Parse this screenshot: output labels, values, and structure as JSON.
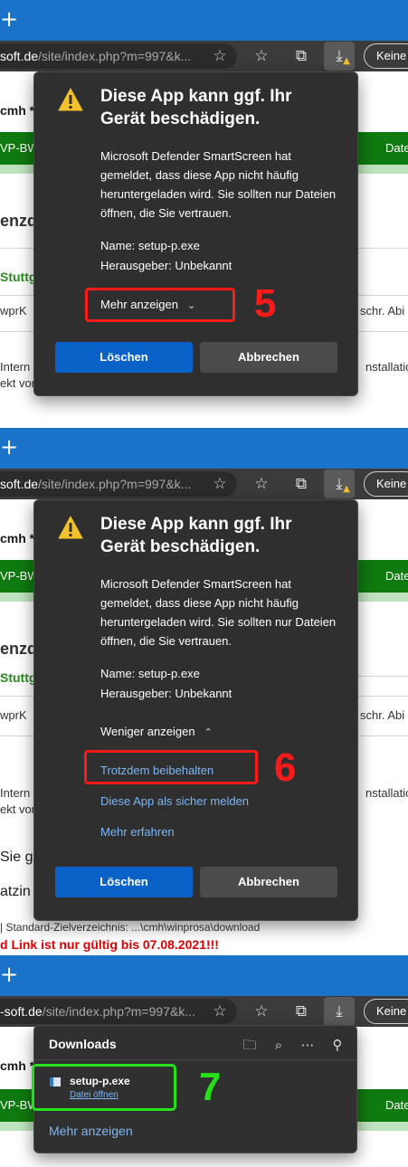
{
  "browser": {
    "new_tab": "+",
    "url_domain": "soft.de",
    "url_path": "/site/index.php?m=997&k...",
    "url_domain_2": "-soft.de",
    "profile_pill": "Keine S",
    "profile_pill_3": "Keine"
  },
  "website": {
    "line_cmh_1": "cmh * S",
    "line_cmh_3": "cmh *",
    "green_left": "VP-BW,",
    "green_left_3": "VP-BW,",
    "green_right": "Date",
    "heading": "enzd",
    "stuttgart": "Stuttg",
    "row_left": "wprK",
    "row_right": "schr. Abi",
    "inter": "Intern",
    "inter_right": "nstallatio",
    "ekt": "ekt vor",
    "sie": "Sie g",
    "atz": "atzin",
    "standard_dir": "| Standard-Zielverzeichnis: ...\\cmh\\winprosa\\download",
    "red_notice": "d Link ist nur gültig bis 07.08.2021!!!"
  },
  "smartscreen": {
    "title": "Diese App kann ggf. Ihr Gerät beschädigen.",
    "body": "Microsoft Defender SmartScreen hat gemeldet, dass diese App nicht häufig heruntergeladen wird. Sie sollten nur Dateien öffnen, die Sie vertrauen.",
    "name_line": "Name: setup-p.exe",
    "publisher_line": "Herausgeber: Unbekannt",
    "show_more": "Mehr anzeigen",
    "show_less": "Weniger anzeigen",
    "keep_anyway": "Trotzdem beibehalten",
    "report_safe": "Diese App als sicher melden",
    "learn_more": "Mehr erfahren",
    "delete": "Löschen",
    "cancel": "Abbrechen"
  },
  "downloads": {
    "title": "Downloads",
    "file_name": "setup-p.exe",
    "open_file": "Datei öffnen",
    "show_more": "Mehr anzeigen"
  },
  "annotations": {
    "step5": "5",
    "step6": "6",
    "step7": "7"
  },
  "colors": {
    "tab_blue": "#1a73c8",
    "toolbar_dark": "#3b3b3b",
    "flyout_bg": "#2f2f2f",
    "button_blue": "#0a62c8",
    "link_blue": "#7db6f5",
    "warning_yellow": "#f2c12e",
    "site_green": "#0f7a0f",
    "annotation_red": "#ff1a1a",
    "annotation_green": "#26e01a"
  },
  "icons": [
    "plus-icon",
    "favorite-add-icon",
    "favorites-icon",
    "collections-icon",
    "download-icon",
    "warning-icon",
    "chevron-down-icon",
    "chevron-up-icon",
    "folder-icon",
    "search-icon",
    "more-icon",
    "pin-icon",
    "file-icon"
  ]
}
